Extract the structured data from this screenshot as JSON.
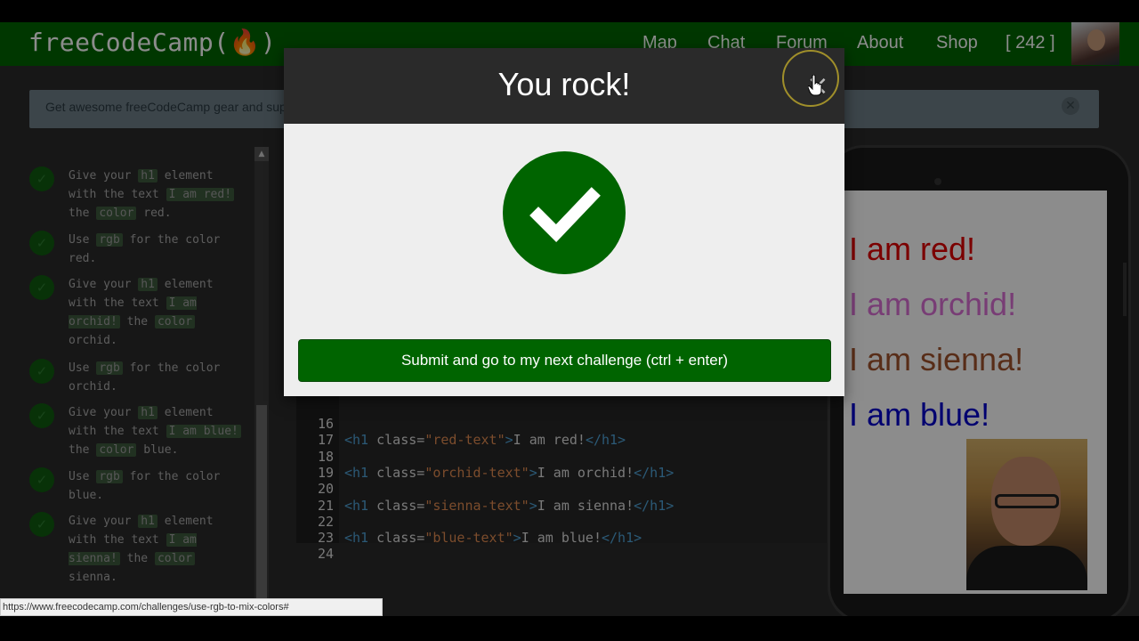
{
  "navbar": {
    "brand": "freeCodeCamp(🔥)",
    "links": {
      "map": "Map",
      "chat": "Chat",
      "forum": "Forum",
      "about": "About",
      "shop": "Shop",
      "points": "[ 242 ]"
    }
  },
  "banner": {
    "text": "Get awesome freeCodeCamp gear and sup"
  },
  "instructions": [
    {
      "parts": [
        "Give your ",
        "h1",
        " element with the text ",
        "I am red!",
        " the ",
        "color",
        " red."
      ]
    },
    {
      "parts": [
        "Use ",
        "rgb",
        " for the color red."
      ]
    },
    {
      "parts": [
        "Give your ",
        "h1",
        " element with the text ",
        "I am orchid!",
        " the ",
        "color",
        " orchid."
      ]
    },
    {
      "parts": [
        "Use ",
        "rgb",
        " for the color orchid."
      ]
    },
    {
      "parts": [
        "Give your ",
        "h1",
        " element with the text ",
        "I am blue!",
        " the ",
        "color",
        " blue."
      ]
    },
    {
      "parts": [
        "Use ",
        "rgb",
        " for the color blue."
      ]
    },
    {
      "parts": [
        "Give your ",
        "h1",
        " element with the text ",
        "I am sienna!",
        " the ",
        "color",
        " sienna."
      ]
    }
  ],
  "editor": {
    "lines": [
      {
        "n": "16",
        "cls": "",
        "text": ""
      },
      {
        "n": "17",
        "cls": "red-text",
        "text": "I am red!"
      },
      {
        "n": "18",
        "cls": "",
        "text": ""
      },
      {
        "n": "19",
        "cls": "orchid-text",
        "text": "I am orchid!"
      },
      {
        "n": "20",
        "cls": "",
        "text": ""
      },
      {
        "n": "21",
        "cls": "sienna-text",
        "text": "I am sienna!"
      },
      {
        "n": "22",
        "cls": "",
        "text": ""
      },
      {
        "n": "23",
        "cls": "blue-text",
        "text": "I am blue!"
      },
      {
        "n": "24",
        "cls": "",
        "text": ""
      }
    ]
  },
  "preview": {
    "headings": [
      {
        "text": "I am red!",
        "color": "#e00000"
      },
      {
        "text": "I am orchid!",
        "color": "#da70d6"
      },
      {
        "text": "I am sienna!",
        "color": "#a0522d"
      },
      {
        "text": "I am blue!",
        "color": "#0000cc"
      }
    ]
  },
  "modal": {
    "title": "You rock!",
    "close": "×",
    "submit_label": "Submit and go to my next challenge (ctrl + enter)"
  },
  "statusbar": {
    "url": "https://www.freecodecamp.com/challenges/use-rgb-to-mix-colors#"
  },
  "colors": {
    "brand_green": "#006400",
    "dark_bg": "#2a2a2a"
  }
}
